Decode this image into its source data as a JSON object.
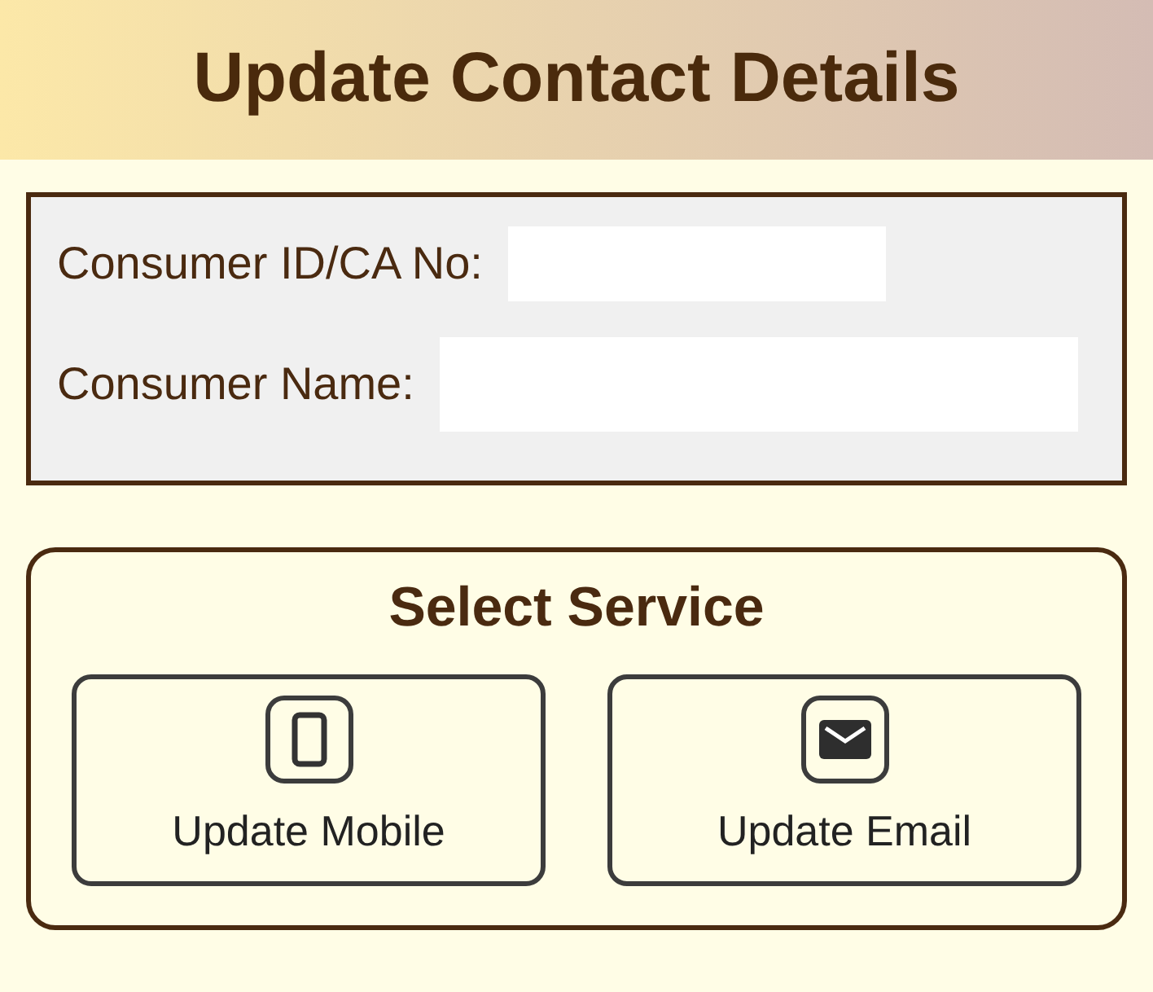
{
  "title": "Update Contact Details",
  "fields": [
    {
      "label": "Consumer ID/CA No:"
    },
    {
      "label": "Consumer Name:"
    }
  ],
  "service_section": {
    "title": "Select Service",
    "options": [
      {
        "kind": "mobile",
        "label": "Update Mobile"
      },
      {
        "kind": "email",
        "label": "Update Email"
      }
    ]
  }
}
